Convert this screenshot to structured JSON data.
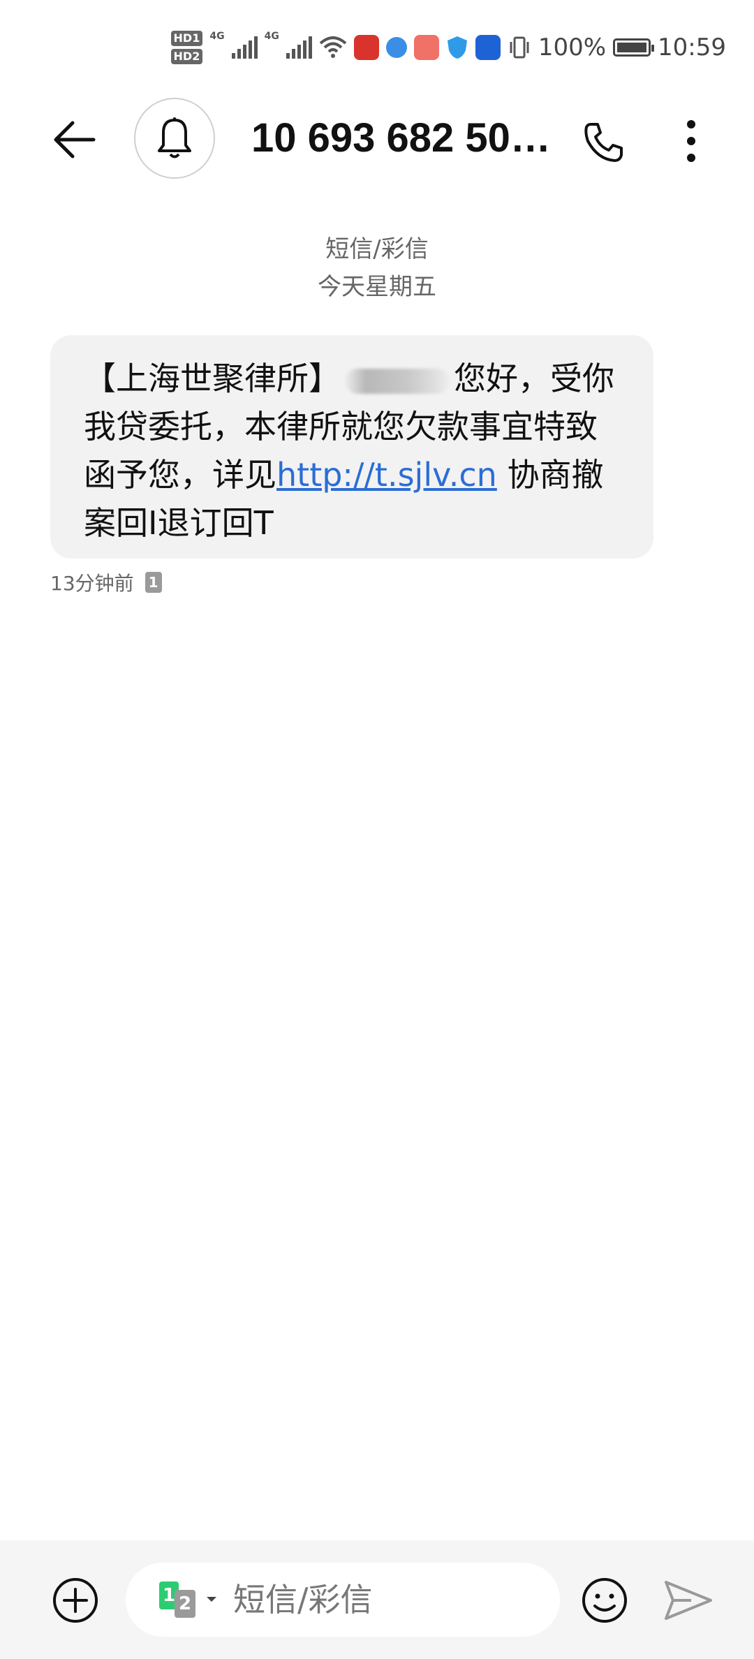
{
  "status_bar": {
    "hd1": "HD1",
    "hd2": "HD2",
    "net1": "4G",
    "net2": "4G",
    "battery": "100%",
    "time": "10:59",
    "icons": [
      "wifi-icon",
      "app-red-icon",
      "browser-icon",
      "shop-icon",
      "shield-icon",
      "lightbulb-icon",
      "vibrate-icon"
    ]
  },
  "header": {
    "title": "10 693 682 50…",
    "back_icon": "back-arrow-icon",
    "avatar_icon": "bell-icon",
    "call_icon": "phone-icon",
    "more_icon": "more-vertical-icon"
  },
  "thread_meta": {
    "type": "短信/彩信",
    "date": "今天星期五"
  },
  "message": {
    "part1": "【上海世聚律所】",
    "part2": "您好，受你我贷委托，本律所就您欠款事宜特致函予您，详见",
    "link": "http://t.sjlv.cn",
    "part3": " 协商撤案回I退订回T",
    "time": "13分钟前",
    "sim": "1"
  },
  "composer": {
    "sim1": "1",
    "sim2": "2",
    "placeholder": "短信/彩信",
    "add_icon": "add-circle-icon",
    "emoji_icon": "emoji-icon",
    "send_icon": "send-icon"
  },
  "colors": {
    "link": "#2a6dd6",
    "bubble_bg": "#f2f2f2",
    "sim1_green": "#2ecc71"
  }
}
